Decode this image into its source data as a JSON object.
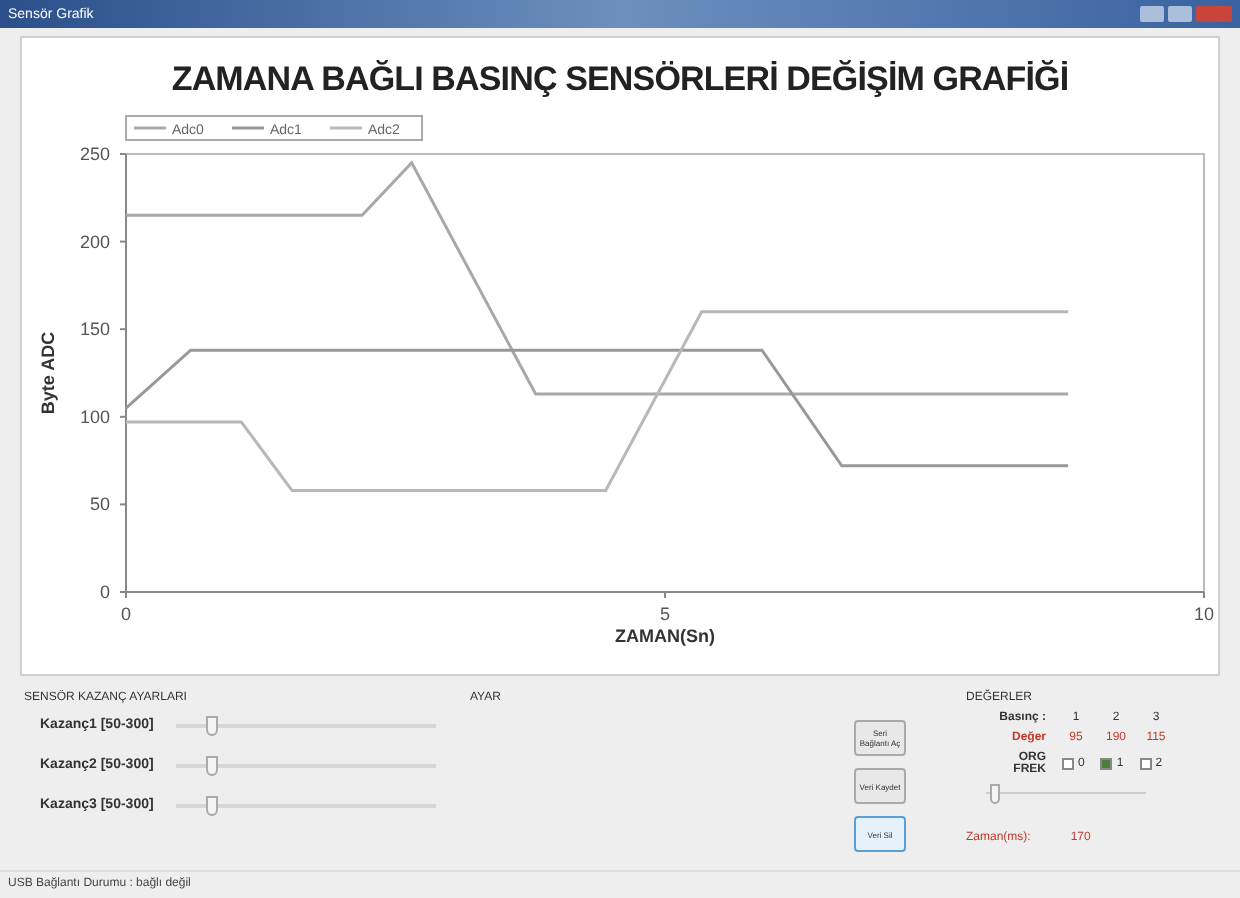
{
  "window": {
    "title": "Sensör Grafik"
  },
  "chart": {
    "title": "ZAMANA BAĞLI BASINÇ SENSÖRLERİ DEĞİŞİM GRAFİĞİ",
    "chart_data": {
      "type": "line",
      "xlabel": "ZAMAN(Sn)",
      "ylabel": "Byte ADC",
      "x": [
        0,
        0.6,
        1.07,
        1.54,
        2.19,
        2.65,
        3.8,
        4.45,
        5.34,
        5.9,
        6.64,
        8.74
      ],
      "series": [
        {
          "name": "Adc0",
          "color": "#a8a8a8",
          "values": [
            215,
            215,
            215,
            215,
            215,
            245,
            113,
            113,
            113,
            113,
            113,
            113
          ]
        },
        {
          "name": "Adc1",
          "color": "#989898",
          "values": [
            105,
            138,
            138,
            138,
            138,
            138,
            138,
            138,
            138,
            138,
            72,
            72
          ]
        },
        {
          "name": "Adc2",
          "color": "#b8b8b8",
          "values": [
            97,
            97,
            97,
            58,
            58,
            58,
            58,
            58,
            160,
            160,
            160,
            160
          ]
        }
      ],
      "legend": true,
      "xlim": [
        0,
        10
      ],
      "ylim": [
        0,
        250
      ],
      "xticks": [
        0,
        5,
        10
      ],
      "yticks": [
        0,
        50,
        100,
        150,
        200,
        250
      ]
    }
  },
  "gains": {
    "title": "SENSÖR KAZANÇ AYARLARI",
    "items": [
      {
        "label": "Kazanç1 [50-300]",
        "level": 0.12
      },
      {
        "label": "Kazanç2 [50-300]",
        "level": 0.12
      },
      {
        "label": "Kazanç3 [50-300]",
        "level": 0.12
      }
    ]
  },
  "settings": {
    "title": "AYAR",
    "buttons": [
      {
        "label": "Seri Bağlantı Aç",
        "selected": false
      },
      {
        "label": "Veri Kaydet",
        "selected": false
      },
      {
        "label": "Veri Sil",
        "selected": true
      }
    ]
  },
  "values": {
    "title": "DEĞERLER",
    "header_label": "Basınç :",
    "header": [
      "1",
      "2",
      "3"
    ],
    "value_label": "Değer",
    "readings": [
      "95",
      "190",
      "115"
    ],
    "options_label": "ORG FREK",
    "options": [
      {
        "label": "0",
        "checked": false
      },
      {
        "label": "1",
        "checked": true
      },
      {
        "label": "2",
        "checked": false
      }
    ],
    "slider": {
      "level": 0.02
    },
    "time_label": "Zaman(ms):",
    "time": "170"
  },
  "status_bar": {
    "text": "USB Bağlantı Durumu : bağlı değil"
  }
}
